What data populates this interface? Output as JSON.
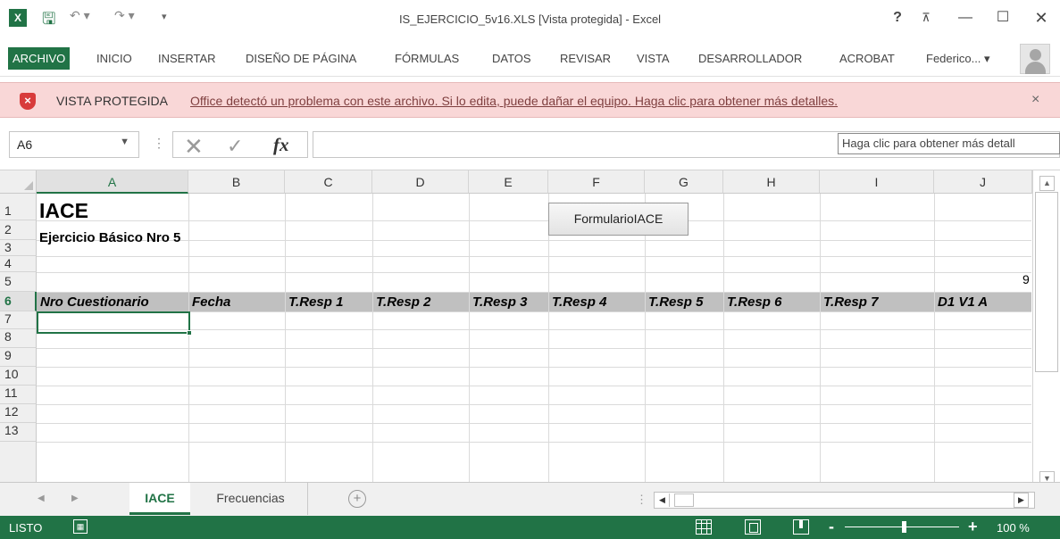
{
  "window": {
    "title": "IS_EJERCICIO_5v16.XLS  [Vista protegida] - Excel",
    "help": "?",
    "ribbon_display": "⊼",
    "minimize": "—",
    "maximize": "☐",
    "close": "✕",
    "qat": {
      "save": "🖫",
      "undo": "↶ ▾",
      "redo": "↷ ▾",
      "customize": "▾"
    }
  },
  "ribbon": {
    "file_tab": "ARCHIVO",
    "tabs": [
      "INICIO",
      "INSERTAR",
      "DISEÑO DE PÁGINA",
      "FÓRMULAS",
      "DATOS",
      "REVISAR",
      "VISTA",
      "DESARROLLADOR",
      "ACROBAT"
    ],
    "user": "Federico... ▾"
  },
  "protected_view": {
    "title": "VISTA PROTEGIDA",
    "message": "Office detectó un problema con este archivo. Si lo edita, puede dañar el equipo. Haga clic para obtener más detalles.",
    "close": "×",
    "icon_color": "#d83b3b"
  },
  "formula_bar": {
    "name_box": "A6",
    "name_box_arrow": "▼",
    "separator": "⋮",
    "cancel": "✕",
    "enter": "✓",
    "fx": "fx",
    "value": "",
    "tooltip": "Haga clic para obtener más detall"
  },
  "grid": {
    "columns": [
      "A",
      "B",
      "C",
      "D",
      "E",
      "F",
      "G",
      "H",
      "I",
      "J"
    ],
    "rows": [
      "1",
      "2",
      "3",
      "4",
      "5",
      "6",
      "7",
      "8",
      "9",
      "10",
      "11",
      "12",
      "13"
    ],
    "selected_column": "A",
    "selected_row": "6",
    "cells": {
      "A1": "IACE",
      "A2": "Ejercicio Básico Nro 5",
      "J4": "9"
    },
    "header_row": [
      "Nro Cuestionario",
      "Fecha",
      "T.Resp 1",
      "T.Resp 2",
      "T.Resp 3",
      "T.Resp 4",
      "T.Resp 5",
      "T.Resp 6",
      "T.Resp 7",
      "D1 V1 A"
    ],
    "form_button": "FormularioIACE",
    "scroll_up": "▲",
    "scroll_down": "▼"
  },
  "sheets": {
    "nav_prev": "◀",
    "nav_next": "▶",
    "tabs": [
      "IACE",
      "Frecuencias"
    ],
    "active": "IACE",
    "add": "+",
    "hscroll_sep": "⋮",
    "hscroll_left": "◀",
    "hscroll_right": "▶"
  },
  "status": {
    "text": "LISTO",
    "macro_icon": "▦",
    "zoom_minus": "-",
    "zoom_plus": "+",
    "zoom": "100 %",
    "accent_color": "#217346"
  }
}
